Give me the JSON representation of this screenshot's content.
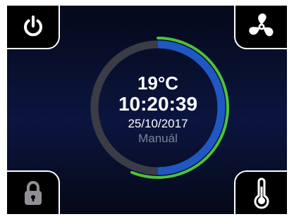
{
  "buttons": {
    "power": {
      "icon": "power-icon"
    },
    "fan": {
      "icon": "fan-icon"
    },
    "lock": {
      "icon": "lock-icon"
    },
    "thermometer": {
      "icon": "thermometer-icon"
    }
  },
  "status": {
    "temperature": "19°C",
    "time": "10:20:39",
    "date": "25/10/2017",
    "mode": "Manuál"
  },
  "dial": {
    "level_fraction": 0.5,
    "colors": {
      "track": "#3a3d45",
      "level": "#1f58c4",
      "outer_ring": "#4cc23a"
    }
  },
  "colors": {
    "background_top": "#05091a",
    "background_mid": "#0b1540",
    "corner_fill": "#000000",
    "corner_border": "#ffffff",
    "text": "#ffffff",
    "mode_text": "#7c8398"
  }
}
